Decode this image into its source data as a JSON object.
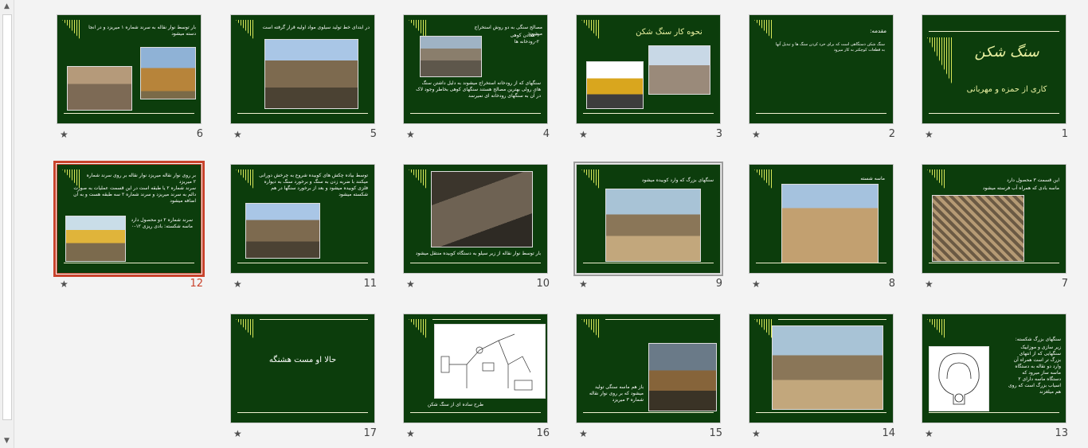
{
  "slides": [
    {
      "number": "1",
      "title": "سنگ شکن",
      "subtitle": "کاری از حمزه و مهربانی"
    },
    {
      "number": "2",
      "heading": "مقدمه:",
      "body": "سنگ شکن دستگاهی است که برای خرد کردن سنگ ها و تبدیل آنها به قطعات کوچکتر به کار میرود"
    },
    {
      "number": "3",
      "heading": "نحوه کار سنگ شکن"
    },
    {
      "number": "4",
      "heading": "مصالح سنگی به دو روش استخراج میشود:",
      "items": [
        "۱-معادن کوهی",
        "۲-رودخانه ها"
      ],
      "body": "سنگهای که از رودخانه استخراج میشوند به دلیل داشتن سنگ های رولی بهترین مصالح هستند سنگهای کوهی بخاطر وجود لاک در آن به سنگهای رودخانه ای نمیرسد"
    },
    {
      "number": "5",
      "heading": "در ابتدای خط تولید سیلوی مواد اولیه قرار گرفته است"
    },
    {
      "number": "6",
      "heading": "بار توسط نوار نقاله به سرند شماره ۱ میریزد و در انجا دسته میشود"
    },
    {
      "number": "7",
      "heading": "این قسمت ۳ محصول دارد",
      "body": "ماسه بادی که همراه آب فرسته میشود"
    },
    {
      "number": "8",
      "heading": "ماسه شسته"
    },
    {
      "number": "9",
      "heading": "سنگهای بزرگ که وارد کوبیده میشود"
    },
    {
      "number": "10",
      "heading": "بار توسط نوار نقاله از زیر سیلو به دستگاه کوبیده منتقل میشود"
    },
    {
      "number": "11",
      "heading": "توسط بیاده چکش های کوبیده شروع به چرخش دورانی میکنند با ضربه زدن به سنگ و برخورد سنگ به دیواره فلزی کوبیده میشود و بعد از برخورد سنگها در هم شکسته میشود"
    },
    {
      "number": "12",
      "heading": "بر روی نوار نقاله میریزد نوار نقاله بر روی سرند شماره ۲ میریزد",
      "body": "سرند شماره ۲ یا طبقه است در این قسمت عملیات به صورت دائم به سرند میریزد و سرند شماره ۲ سه طبقه هست و به آن اضافه میشود",
      "items": [
        "سرند شماره ۲ دو محصول دارد",
        "ماسه شکسته: بادی ریزی ۱۲-۰"
      ]
    },
    {
      "number": "13",
      "heading": "سنگهای بزرگ شکسته:",
      "body": "زیر سازی و موزاییک سنگهایی که از انتهای بزرگ تر است همراه آن وارد دو نقاله به دستگاه ماسه ساز میرود که دستگاه ماسه دارای ۲ اسیاب بزرگ است که روی هم میلغزند"
    },
    {
      "number": "14",
      "heading": ""
    },
    {
      "number": "15",
      "heading": "باز هم ماسه سنگی تولید میشود که بر روی نوار نقاله شماره ۳ میریزد"
    },
    {
      "number": "16",
      "heading": "طرح ساده ای از سنگ شکن"
    },
    {
      "number": "17",
      "title": "حالا او مست هشنگه"
    }
  ],
  "selected_slide": "12",
  "star_icon": "★",
  "colors": {
    "slide_bg": "#0c3d0c",
    "selected": "#c9432c",
    "accent": "#e8f0a0"
  }
}
